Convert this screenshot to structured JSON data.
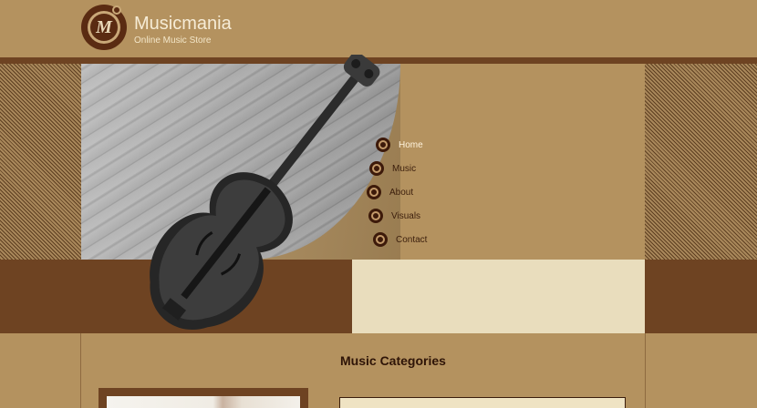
{
  "site": {
    "logo_letter": "M",
    "title": "Musicmania",
    "tagline": "Online Music Store"
  },
  "nav": {
    "items": [
      {
        "label": "Home",
        "active": true
      },
      {
        "label": "Music",
        "active": false
      },
      {
        "label": "About",
        "active": false
      },
      {
        "label": "Visuals",
        "active": false
      },
      {
        "label": "Contact",
        "active": false
      }
    ]
  },
  "content": {
    "section_title": "Music Categories"
  },
  "colors": {
    "background": "#b4925f",
    "dark_brown": "#6e4322",
    "cream": "#e9ddbd",
    "nav_text": "#3b1e0c",
    "nav_active": "#fff3dc"
  },
  "icons": {
    "logo": "musicmania-logo-icon",
    "nav_bullet": "circle-bullet-icon"
  }
}
